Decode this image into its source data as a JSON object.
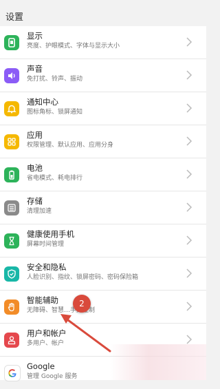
{
  "header": {
    "title": "设置"
  },
  "items": [
    {
      "title": "显示",
      "subtitle": "亮度、护眼模式、字体与显示大小",
      "icon": "display-icon",
      "color": "#2db35a"
    },
    {
      "title": "声音",
      "subtitle": "免打扰、铃声、振动",
      "icon": "speaker-icon",
      "color": "#8b5cf6"
    },
    {
      "title": "通知中心",
      "subtitle": "图标角标、锁屏通知",
      "icon": "bell-icon",
      "color": "#f5b800"
    },
    {
      "title": "应用",
      "subtitle": "权限管理、默认应用、应用分身",
      "icon": "apps-grid-icon",
      "color": "#f5b800"
    },
    {
      "title": "电池",
      "subtitle": "省电模式、耗电排行",
      "icon": "battery-icon",
      "color": "#2db35a"
    },
    {
      "title": "存储",
      "subtitle": "清理加速",
      "icon": "storage-icon",
      "color": "#8a8a8a"
    },
    {
      "title": "健康使用手机",
      "subtitle": "屏幕时间管理",
      "icon": "hourglass-icon",
      "color": "#2db35a"
    },
    {
      "title": "安全和隐私",
      "subtitle": "人脸识别、指纹、锁屏密码、密码保险箱",
      "icon": "shield-icon",
      "color": "#18b7a7"
    },
    {
      "title": "智能辅助",
      "subtitle": "无障碍、智慧…手势控制",
      "icon": "hand-icon",
      "color": "#f28c28"
    },
    {
      "title": "用户和帐户",
      "subtitle": "多用户、帐户",
      "icon": "user-icon",
      "color": "#e5484d"
    },
    {
      "title": "Google",
      "subtitle": "管理 Google 服务",
      "icon": "google-g-icon",
      "color": "#ffffff"
    }
  ],
  "annotation": {
    "step_number": "2",
    "color": "#d94a3c"
  }
}
